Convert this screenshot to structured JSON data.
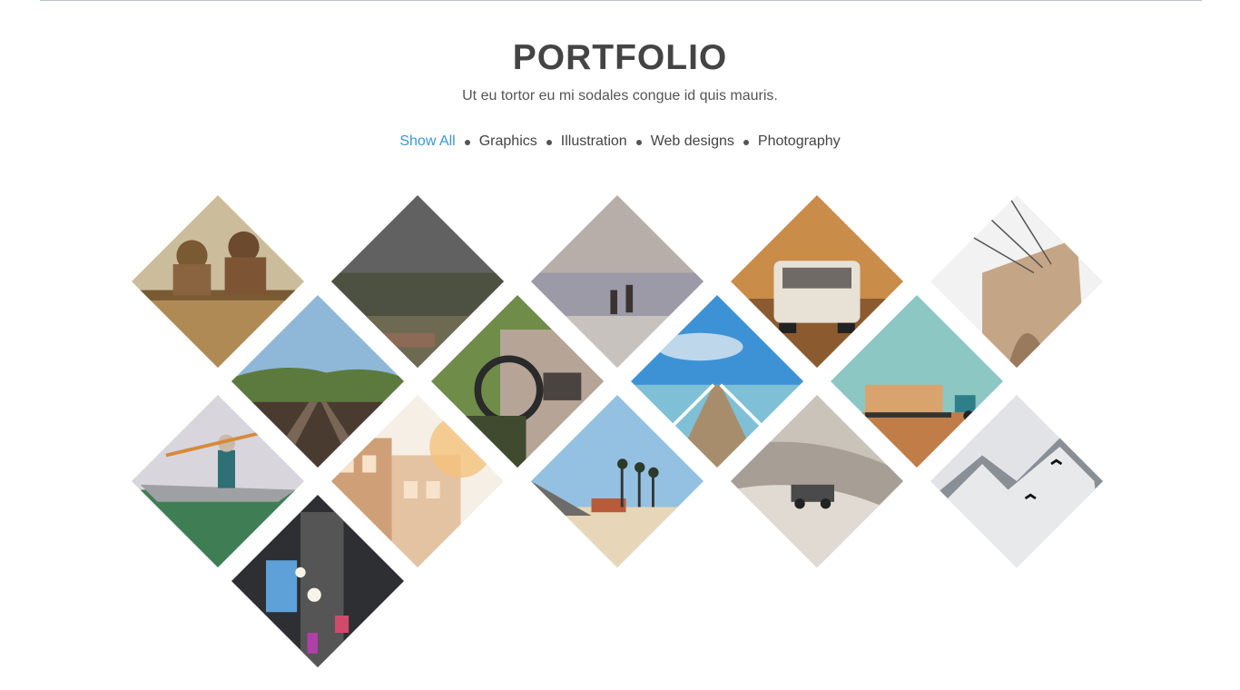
{
  "portfolio": {
    "title": "PORTFOLIO",
    "subtitle": "Ut eu tortor eu mi sodales congue id quis mauris."
  },
  "filters": [
    {
      "label": "Show All",
      "active": true
    },
    {
      "label": "Graphics",
      "active": false
    },
    {
      "label": "Illustration",
      "active": false
    },
    {
      "label": "Web designs",
      "active": false
    },
    {
      "label": "Photography",
      "active": false
    }
  ],
  "colors": {
    "accent": "#3a97d4",
    "text": "#444444"
  },
  "gallery": [
    {
      "subject": "couple-on-bench",
      "colors": [
        "#cbbd9c",
        "#b08a55",
        "#7a5a33"
      ]
    },
    {
      "subject": "hillside-grass",
      "colors": [
        "#616161",
        "#4d5141",
        "#6e6a52"
      ]
    },
    {
      "subject": "beach-waders",
      "colors": [
        "#b7aeaa",
        "#9c9aa7",
        "#c7c2bd"
      ]
    },
    {
      "subject": "vintage-van",
      "colors": [
        "#c98c49",
        "#8b5a2e",
        "#e7e1d6"
      ]
    },
    {
      "subject": "bridge-arch",
      "colors": [
        "#f2f2f2",
        "#c4a687",
        "#9a7a5c"
      ]
    },
    {
      "subject": "railway-tracks",
      "colors": [
        "#8fb7d8",
        "#5d7a3e",
        "#4a3b30"
      ]
    },
    {
      "subject": "car-interior",
      "colors": [
        "#6f8c49",
        "#3f4a2f",
        "#b6a497"
      ]
    },
    {
      "subject": "pier-sea",
      "colors": [
        "#3d92d6",
        "#bfd7ea",
        "#a88d6d"
      ]
    },
    {
      "subject": "hay-bales-tractor",
      "colors": [
        "#8cc7c4",
        "#c07d47",
        "#d9a36d"
      ]
    },
    {
      "subject": "kayak-paddler",
      "colors": [
        "#d8d5dc",
        "#3f7e55",
        "#9fa0a3"
      ]
    },
    {
      "subject": "sunlit-building",
      "colors": [
        "#f6efe6",
        "#cf9f77",
        "#f4c27a"
      ]
    },
    {
      "subject": "palm-beach",
      "colors": [
        "#94c1e1",
        "#e8d6b8",
        "#6e6c69"
      ]
    },
    {
      "subject": "desert-jeep",
      "colors": [
        "#cac3b9",
        "#a79f95",
        "#e0dad3"
      ]
    },
    {
      "subject": "snowy-mountain",
      "colors": [
        "#e1e3e6",
        "#8a8f96",
        "#ffffff"
      ]
    },
    {
      "subject": "city-night",
      "colors": [
        "#2e2f33",
        "#555",
        "#5da1d8"
      ]
    }
  ]
}
